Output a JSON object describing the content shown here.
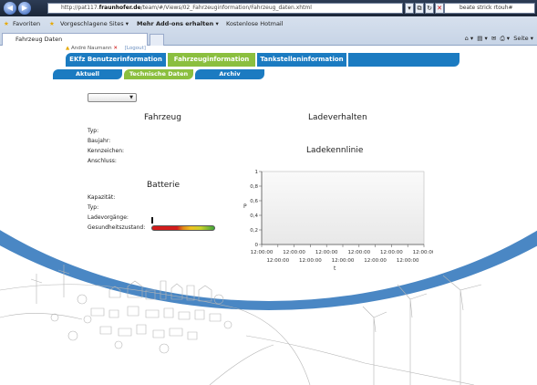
{
  "browser": {
    "url_prefix": "http://pat117.",
    "url_domain": "fraunhofer.de",
    "url_path": "/team/#/Views/02_Fahrzeuginformation/Fahrzeug_daten.xhtml",
    "search_text": "beate strick rtouh#",
    "favorites_label": "Favoriten",
    "fav_items": [
      "Vorgeschlagene Sites ▾",
      "Mehr Add-ons erhalten ▾",
      "Kostenlose Hotmail"
    ],
    "tab_title": "Fahrzeug Daten",
    "page_menu": "Seite ▾"
  },
  "user": {
    "name": "André Naumann",
    "logout": "[Logout]"
  },
  "nav_tabs": [
    "EKfz Benutzerinformation",
    "Fahrzeuginformation",
    "Tankstelleninformation",
    ""
  ],
  "sub_tabs": [
    "Aktuell",
    "Technische Daten",
    "Archiv"
  ],
  "colors": {
    "nav_blue": "#1b7bc1",
    "active_green": "#8bbf3f"
  },
  "vehicle": {
    "title": "Fahrzeug",
    "labels": [
      "Typ:",
      "Baujahr:",
      "Kennzeichen:",
      "Anschluss:"
    ]
  },
  "battery": {
    "title": "Batterie",
    "labels": [
      "Kapazität:",
      "Typ:",
      "Ladevorgänge:",
      "Gesundheitszustand:"
    ]
  },
  "charging": {
    "title": "Ladeverhalten",
    "curve_title": "Ladekennlinie"
  },
  "chart_data": {
    "type": "line",
    "title": "Ladekennlinie",
    "xlabel": "t",
    "ylabel": "P",
    "ylim": [
      0,
      1
    ],
    "yticks": [
      "0",
      "0,2",
      "0,4",
      "0,6",
      "0,8",
      "1"
    ],
    "xticks": [
      "12:00:00",
      "12:00:00",
      "12:00:00",
      "12:00:00",
      "12:00:00",
      "12:00:00",
      "12:00:00",
      "12:00:00",
      "12:00:00",
      "12:00:00",
      "12:00:00"
    ],
    "series": []
  }
}
